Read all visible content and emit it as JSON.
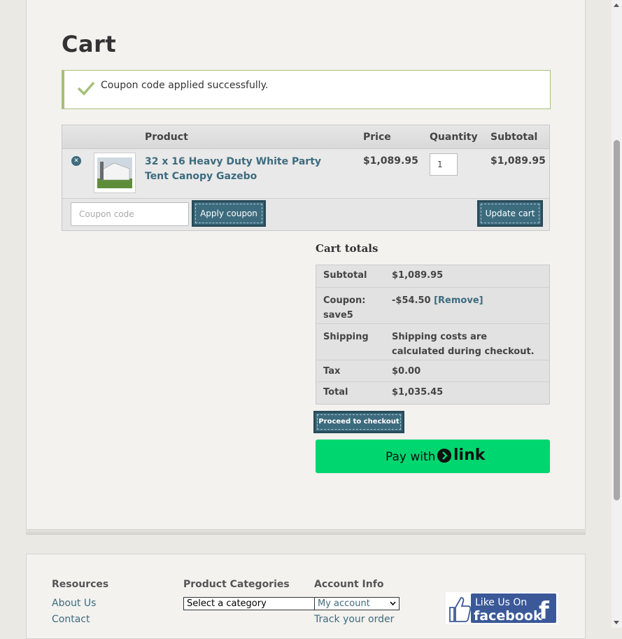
{
  "page": {
    "title": "Cart"
  },
  "notice": {
    "message": "Coupon code applied successfully."
  },
  "cart": {
    "headers": {
      "product": "Product",
      "price": "Price",
      "quantity": "Quantity",
      "subtotal": "Subtotal"
    },
    "items": [
      {
        "name": "32 x 16 Heavy Duty White Party Tent Canopy Gazebo",
        "price": "$1,089.95",
        "quantity": "1",
        "subtotal": "$1,089.95"
      }
    ],
    "coupon_placeholder": "Coupon code",
    "apply_coupon_label": "Apply coupon",
    "update_cart_label": "Update cart"
  },
  "totals": {
    "title": "Cart totals",
    "subtotal_label": "Subtotal",
    "subtotal_value": "$1,089.95",
    "coupon_label": "Coupon: save5",
    "coupon_value": "-$54.50",
    "coupon_remove": "[Remove]",
    "shipping_label": "Shipping",
    "shipping_value": "Shipping costs are calculated during checkout.",
    "tax_label": "Tax",
    "tax_value": "$0.00",
    "total_label": "Total",
    "total_value": "$1,035.45",
    "checkout_label": "Proceed to checkout",
    "pay_with": "Pay with",
    "pay_brand": "link"
  },
  "footer": {
    "resources": {
      "title": "Resources",
      "links": [
        "About Us",
        "Contact"
      ]
    },
    "categories": {
      "title": "Product Categories",
      "select": "Select a category"
    },
    "account": {
      "title": "Account Info",
      "select": "My account",
      "track": "Track your order"
    },
    "facebook": {
      "line1": "Like Us On",
      "line2": "facebook"
    }
  },
  "colors": {
    "accent": "#3d6b7e",
    "notice_border": "#a7bf79",
    "link_pay": "#00d66f"
  }
}
